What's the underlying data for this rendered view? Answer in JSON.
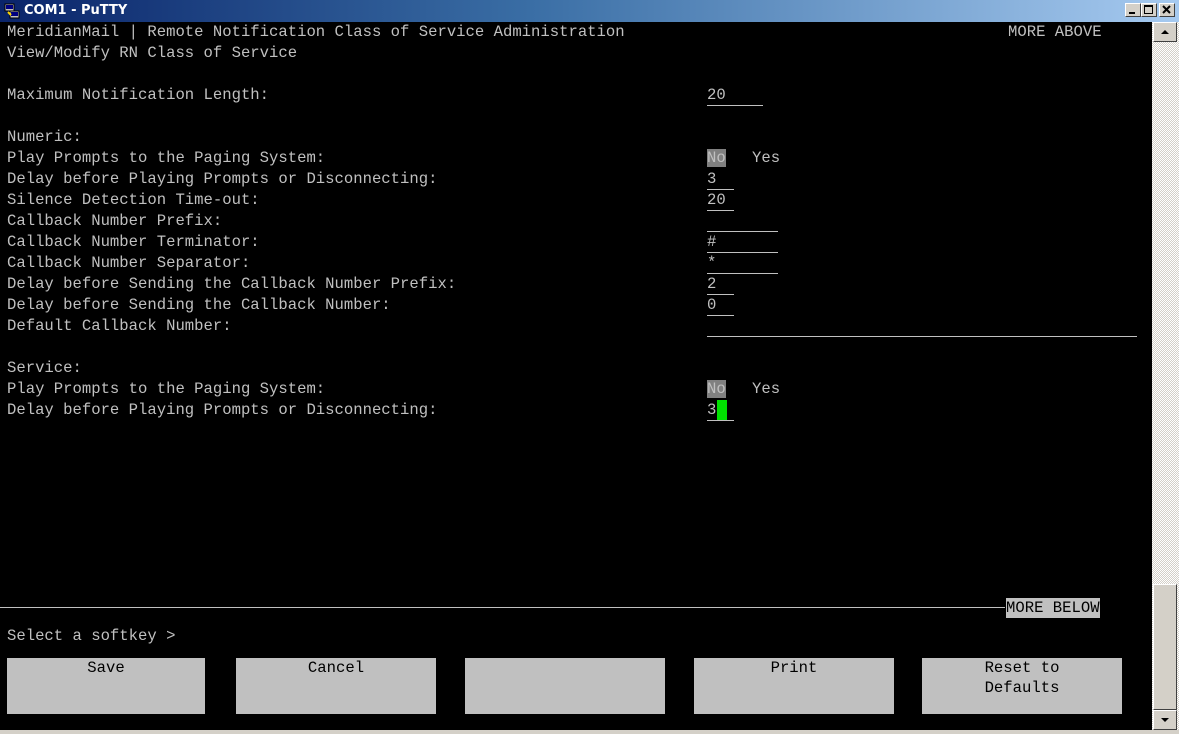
{
  "window": {
    "title": "COM1 - PuTTY"
  },
  "terminal": {
    "header_title": "MeridianMail | Remote Notification Class of Service Administration",
    "header_more": "MORE ABOVE",
    "subtitle": "View/Modify RN Class of Service",
    "max_notification_label": "Maximum Notification Length:",
    "max_notification_value": "20",
    "numeric_heading": "Numeric:",
    "numeric": {
      "play_prompts_label": "Play Prompts to the Paging System:",
      "play_prompts_no": "No",
      "play_prompts_yes": "Yes",
      "delay_prompts_label": "Delay before Playing Prompts or Disconnecting:",
      "delay_prompts_value": "3",
      "silence_label": "Silence Detection Time-out:",
      "silence_value": "20",
      "prefix_label": "Callback Number Prefix:",
      "prefix_value": "",
      "terminator_label": "Callback Number Terminator:",
      "terminator_value": "#",
      "separator_label": "Callback Number Separator:",
      "separator_value": "*",
      "delay_prefix_label": "Delay before Sending the Callback Number Prefix:",
      "delay_prefix_value": "2",
      "delay_callback_label": "Delay before Sending the Callback Number:",
      "delay_callback_value": "0",
      "default_callback_label": "Default Callback Number:",
      "default_callback_value": ""
    },
    "service_heading": "Service:",
    "service": {
      "play_prompts_label": "Play Prompts to the Paging System:",
      "play_prompts_no": "No",
      "play_prompts_yes": "Yes",
      "delay_prompts_label": "Delay before Playing Prompts or Disconnecting:",
      "delay_prompts_value": "3"
    },
    "more_below": "MORE BELOW",
    "prompt": "Select a softkey >",
    "softkeys": [
      "Save",
      "Cancel",
      "",
      "Print",
      "Reset to\nDefaults"
    ]
  },
  "colors": {
    "terminal_bg": "#000000",
    "terminal_fg": "#c0c0c0",
    "cursor": "#00e000",
    "selected_option_bg": "#808080",
    "softkey_bg": "#c0c0c0"
  },
  "icons": {
    "title_icon": "putty-icon",
    "minimize": "minimize-icon",
    "maximize": "maximize-icon",
    "close": "close-icon",
    "scroll_up": "scroll-up-arrow-icon",
    "scroll_down": "scroll-down-arrow-icon"
  }
}
